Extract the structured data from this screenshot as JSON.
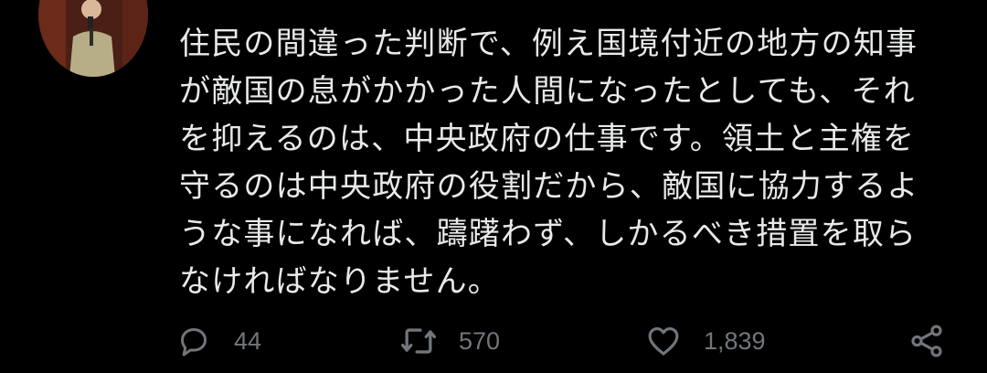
{
  "tweet": {
    "text_lines": [
      "住民の間違った判断で、例え国境付近の地方の知事",
      "が敵国の息がかかった人間になったとしても、それ",
      "を抑えるのは、中央政府の仕事です。領土と主権を",
      "守るのは中央政府の役割だから、敵国に協力するよ",
      "うな事になれば、躊躇わず、しかるべき措置を取ら",
      "なければなりません。"
    ]
  },
  "actions": {
    "reply_count": "44",
    "retweet_count": "570",
    "like_count": "1,839"
  },
  "icons": {
    "reply": "reply-icon",
    "retweet": "retweet-icon",
    "like": "heart-icon",
    "share": "share-icon"
  },
  "colors": {
    "background": "#000000",
    "text": "#e7e9ea",
    "secondary": "#71767b"
  }
}
